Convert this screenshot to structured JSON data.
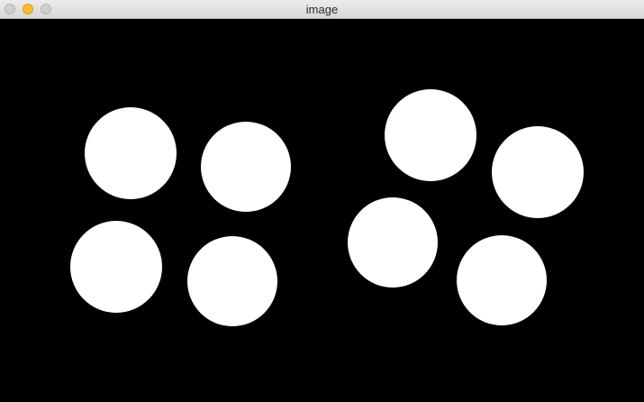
{
  "window": {
    "title": "image",
    "controls": [
      "close-icon",
      "minimize-icon",
      "zoom-icon"
    ]
  },
  "image": {
    "background_color": "#000000",
    "shape_color": "#ffffff",
    "shape": "circle",
    "circle_count": 8
  }
}
